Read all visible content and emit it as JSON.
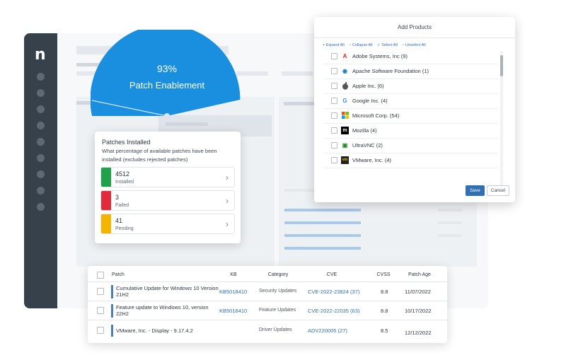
{
  "app": {
    "logo": "n"
  },
  "gauge": {
    "percent": "93%",
    "label": "Patch Enablement",
    "value": 0.93,
    "color": "#1a8fe0"
  },
  "patches_card": {
    "title": "Patches Installed",
    "subtitle": "What percentage of available patches have been installed (excludes rejected patches)",
    "items": [
      {
        "count": "4512",
        "label": "Installed",
        "color": "#1fa24a"
      },
      {
        "count": "3",
        "label": "Failed",
        "color": "#e22a3b"
      },
      {
        "count": "41",
        "label": "Pending",
        "color": "#f4b400"
      }
    ]
  },
  "add_products": {
    "title": "Add Products",
    "actions": [
      "+ Expand All",
      "– Collapse All",
      "✓ Select All",
      "– Unselect All"
    ],
    "products": [
      {
        "name": "Adobe Systems, Inc (9)",
        "icon": "adobe-icon",
        "glyph": "A",
        "color": "#d9261c"
      },
      {
        "name": "Apache Software Foundation (1)",
        "icon": "apache-icon",
        "glyph": "◉",
        "color": "#1c7ec0"
      },
      {
        "name": "Apple Inc. (6)",
        "icon": "apple-icon",
        "glyph": "",
        "color": "#555555"
      },
      {
        "name": "Google Inc. (4)",
        "icon": "google-icon",
        "glyph": "G",
        "color": "#4285f4"
      },
      {
        "name": "Microsoft Corp. (54)",
        "icon": "microsoft-icon",
        "glyph": "",
        "color": "#f25022"
      },
      {
        "name": "Mozilla (4)",
        "icon": "mozilla-icon",
        "glyph": "m",
        "color": "#000000"
      },
      {
        "name": "UltraVNC (2)",
        "icon": "ultravnc-icon",
        "glyph": "▣",
        "color": "#2a8a2a"
      },
      {
        "name": "VMware, Inc. (4)",
        "icon": "vmware-icon",
        "glyph": "vm",
        "color": "#222222"
      }
    ],
    "save_label": "Save",
    "cancel_label": "Cancel"
  },
  "patch_table": {
    "headers": {
      "patch": "Patch",
      "kb": "KB",
      "category": "Category",
      "cve": "CVE",
      "cvss": "CVSS",
      "age": "Patch Age"
    },
    "rows": [
      {
        "patch": "Cumulative Update for Windows 10 Version 21H2",
        "kb": "KB5018410",
        "category": "Security Updates",
        "cve": "CVE-2022-23824 (37)",
        "cvss": "8.8",
        "age": "11/07/2022"
      },
      {
        "patch": "Feature update to Windows 10, version 22H2",
        "kb": "KB5018410",
        "category": "Feature Updates",
        "cve": "CVE-2022-22035 (63)",
        "cvss": "8.8",
        "age": "10/17/2022"
      },
      {
        "patch": "VMware, Inc. - Display - 9.17.4.2",
        "kb": "",
        "category": "Driver Updates",
        "cve": "ADV220005 (27)",
        "cvss": "8.5",
        "age": "12/12/2022"
      }
    ]
  }
}
